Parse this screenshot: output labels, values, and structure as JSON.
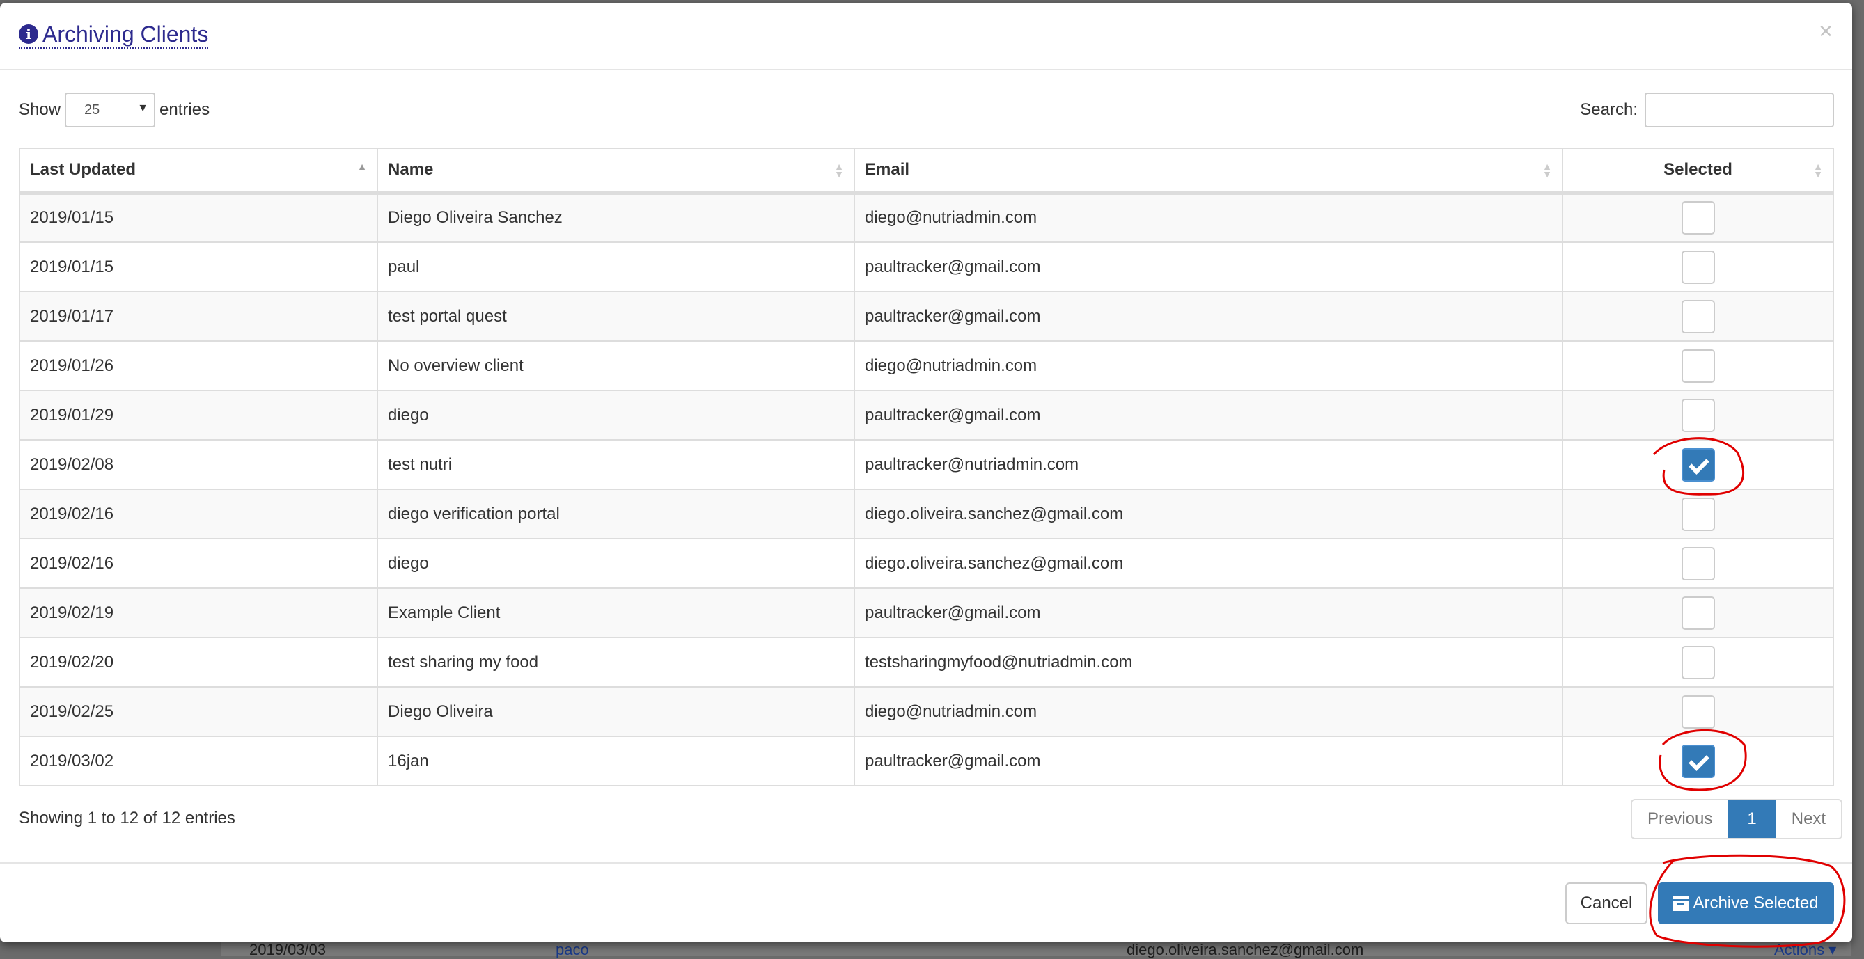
{
  "modal": {
    "title": "Archiving Clients",
    "close_label": "×",
    "show_label": "Show",
    "entries_per_page": "25",
    "entries_label": "entries",
    "search_label": "Search:",
    "search_value": "",
    "columns": [
      "Last Updated",
      "Name",
      "Email",
      "Selected"
    ],
    "sorted_column": "Last Updated",
    "rows": [
      {
        "date": "2019/01/15",
        "name": "Diego Oliveira Sanchez",
        "email": "diego@nutriadmin.com",
        "selected": false
      },
      {
        "date": "2019/01/15",
        "name": "paul",
        "email": "paultracker@gmail.com",
        "selected": false
      },
      {
        "date": "2019/01/17",
        "name": "test portal quest",
        "email": "paultracker@gmail.com",
        "selected": false
      },
      {
        "date": "2019/01/26",
        "name": "No overview client",
        "email": "diego@nutriadmin.com",
        "selected": false
      },
      {
        "date": "2019/01/29",
        "name": "diego",
        "email": "paultracker@gmail.com",
        "selected": false
      },
      {
        "date": "2019/02/08",
        "name": "test nutri",
        "email": "paultracker@nutriadmin.com",
        "selected": true
      },
      {
        "date": "2019/02/16",
        "name": "diego verification portal",
        "email": "diego.oliveira.sanchez@gmail.com",
        "selected": false
      },
      {
        "date": "2019/02/16",
        "name": "diego",
        "email": "diego.oliveira.sanchez@gmail.com",
        "selected": false
      },
      {
        "date": "2019/02/19",
        "name": "Example Client",
        "email": "paultracker@gmail.com",
        "selected": false
      },
      {
        "date": "2019/02/20",
        "name": "test sharing my food",
        "email": "testsharingmyfood@nutriadmin.com",
        "selected": false
      },
      {
        "date": "2019/02/25",
        "name": "Diego Oliveira",
        "email": "diego@nutriadmin.com",
        "selected": false
      },
      {
        "date": "2019/03/02",
        "name": "16jan",
        "email": "paultracker@gmail.com",
        "selected": true
      }
    ],
    "info_text": "Showing 1 to 12 of 12 entries",
    "pagination": {
      "previous": "Previous",
      "current": "1",
      "next": "Next"
    },
    "cancel_label": "Cancel",
    "archive_label": "Archive Selected"
  },
  "background_row": {
    "date": "2019/03/03",
    "name": "paco",
    "email": "diego.oliveira.sanchez@gmail.com",
    "actions": "Actions ▾"
  },
  "colors": {
    "accent": "#337ab7",
    "title": "#2d2a8e",
    "annotation": "#e00000"
  }
}
